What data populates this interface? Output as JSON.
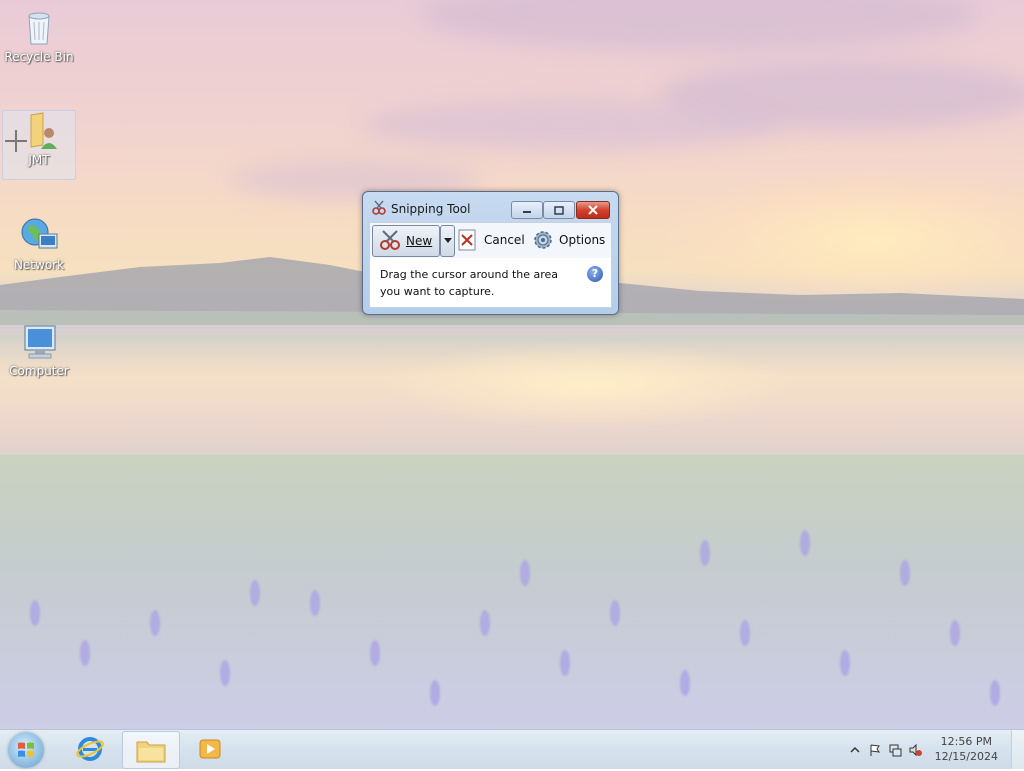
{
  "desktop": {
    "icons": [
      {
        "label": "Recycle Bin",
        "icon": "recycle-bin-icon"
      },
      {
        "label": "JMT",
        "icon": "user-folder-icon"
      },
      {
        "label": "Network",
        "icon": "network-icon"
      },
      {
        "label": "Computer",
        "icon": "computer-icon"
      }
    ]
  },
  "snipping_tool": {
    "title": "Snipping Tool",
    "new_label": "New",
    "cancel_label": "Cancel",
    "options_label": "Options",
    "instructions": "Drag the cursor around the area you want to capture.",
    "help_glyph": "?"
  },
  "taskbar": {
    "apps": [
      {
        "name": "internet-explorer",
        "icon": "internet-explorer-icon"
      },
      {
        "name": "windows-explorer",
        "icon": "folder-icon"
      },
      {
        "name": "media-player",
        "icon": "media-player-icon"
      }
    ],
    "clock": {
      "time": "12:56 PM",
      "date": "12/15/2024"
    }
  }
}
